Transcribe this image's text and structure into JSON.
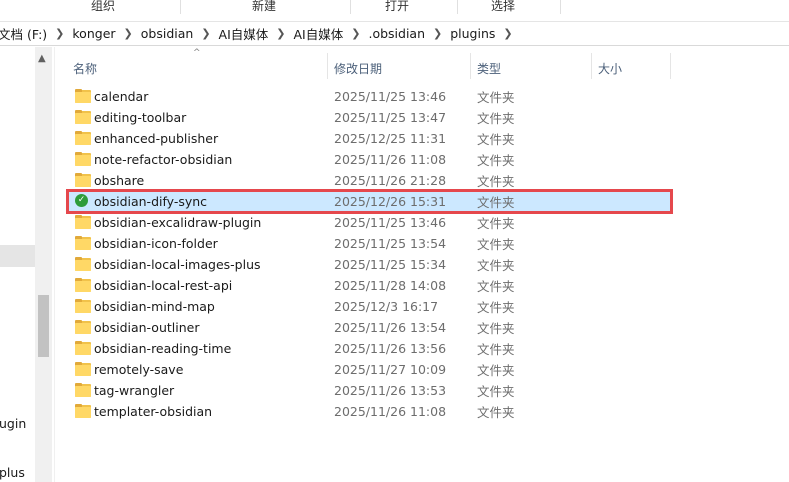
{
  "ribbon": {
    "groups": [
      "组织",
      "新建",
      "打开",
      "选择"
    ]
  },
  "address": {
    "crumbs": [
      "文档 (F:)",
      "konger",
      "obsidian",
      "AI自媒体",
      "AI自媒体",
      ".obsidian",
      "plugins"
    ]
  },
  "nav": {
    "fragments": [
      "ugin",
      "plus"
    ]
  },
  "columns": {
    "name": "名称",
    "date": "修改日期",
    "type": "类型",
    "size": "大小"
  },
  "files": [
    {
      "name": "calendar",
      "date": "2025/11/25 13:46",
      "type": "文件夹",
      "icon": "folder-icon"
    },
    {
      "name": "editing-toolbar",
      "date": "2025/11/25 13:47",
      "type": "文件夹",
      "icon": "folder-icon"
    },
    {
      "name": "enhanced-publisher",
      "date": "2025/12/25 11:31",
      "type": "文件夹",
      "icon": "folder-icon"
    },
    {
      "name": "note-refactor-obsidian",
      "date": "2025/11/26 11:08",
      "type": "文件夹",
      "icon": "folder-icon"
    },
    {
      "name": "obshare",
      "date": "2025/11/26 21:28",
      "type": "文件夹",
      "icon": "folder-icon"
    },
    {
      "name": "obsidian-dify-sync",
      "date": "2025/12/26 15:31",
      "type": "文件夹",
      "icon": "sync-check-icon",
      "selected": true
    },
    {
      "name": "obsidian-excalidraw-plugin",
      "date": "2025/11/25 13:46",
      "type": "文件夹",
      "icon": "folder-icon"
    },
    {
      "name": "obsidian-icon-folder",
      "date": "2025/11/25 13:54",
      "type": "文件夹",
      "icon": "folder-icon"
    },
    {
      "name": "obsidian-local-images-plus",
      "date": "2025/11/25 15:34",
      "type": "文件夹",
      "icon": "folder-icon"
    },
    {
      "name": "obsidian-local-rest-api",
      "date": "2025/11/28 14:08",
      "type": "文件夹",
      "icon": "folder-icon"
    },
    {
      "name": "obsidian-mind-map",
      "date": "2025/12/3 16:17",
      "type": "文件夹",
      "icon": "folder-icon"
    },
    {
      "name": "obsidian-outliner",
      "date": "2025/11/26 13:54",
      "type": "文件夹",
      "icon": "folder-icon"
    },
    {
      "name": "obsidian-reading-time",
      "date": "2025/11/26 13:56",
      "type": "文件夹",
      "icon": "folder-icon"
    },
    {
      "name": "remotely-save",
      "date": "2025/11/27 10:09",
      "type": "文件夹",
      "icon": "folder-icon"
    },
    {
      "name": "tag-wrangler",
      "date": "2025/11/26 13:53",
      "type": "文件夹",
      "icon": "folder-icon"
    },
    {
      "name": "templater-obsidian",
      "date": "2025/11/26 11:08",
      "type": "文件夹",
      "icon": "folder-icon"
    }
  ],
  "colors": {
    "selected_bg": "#cce8ff",
    "highlight_border": "#e5484d",
    "folder": "#ffd866",
    "sync_badge": "#2f9c3a"
  }
}
